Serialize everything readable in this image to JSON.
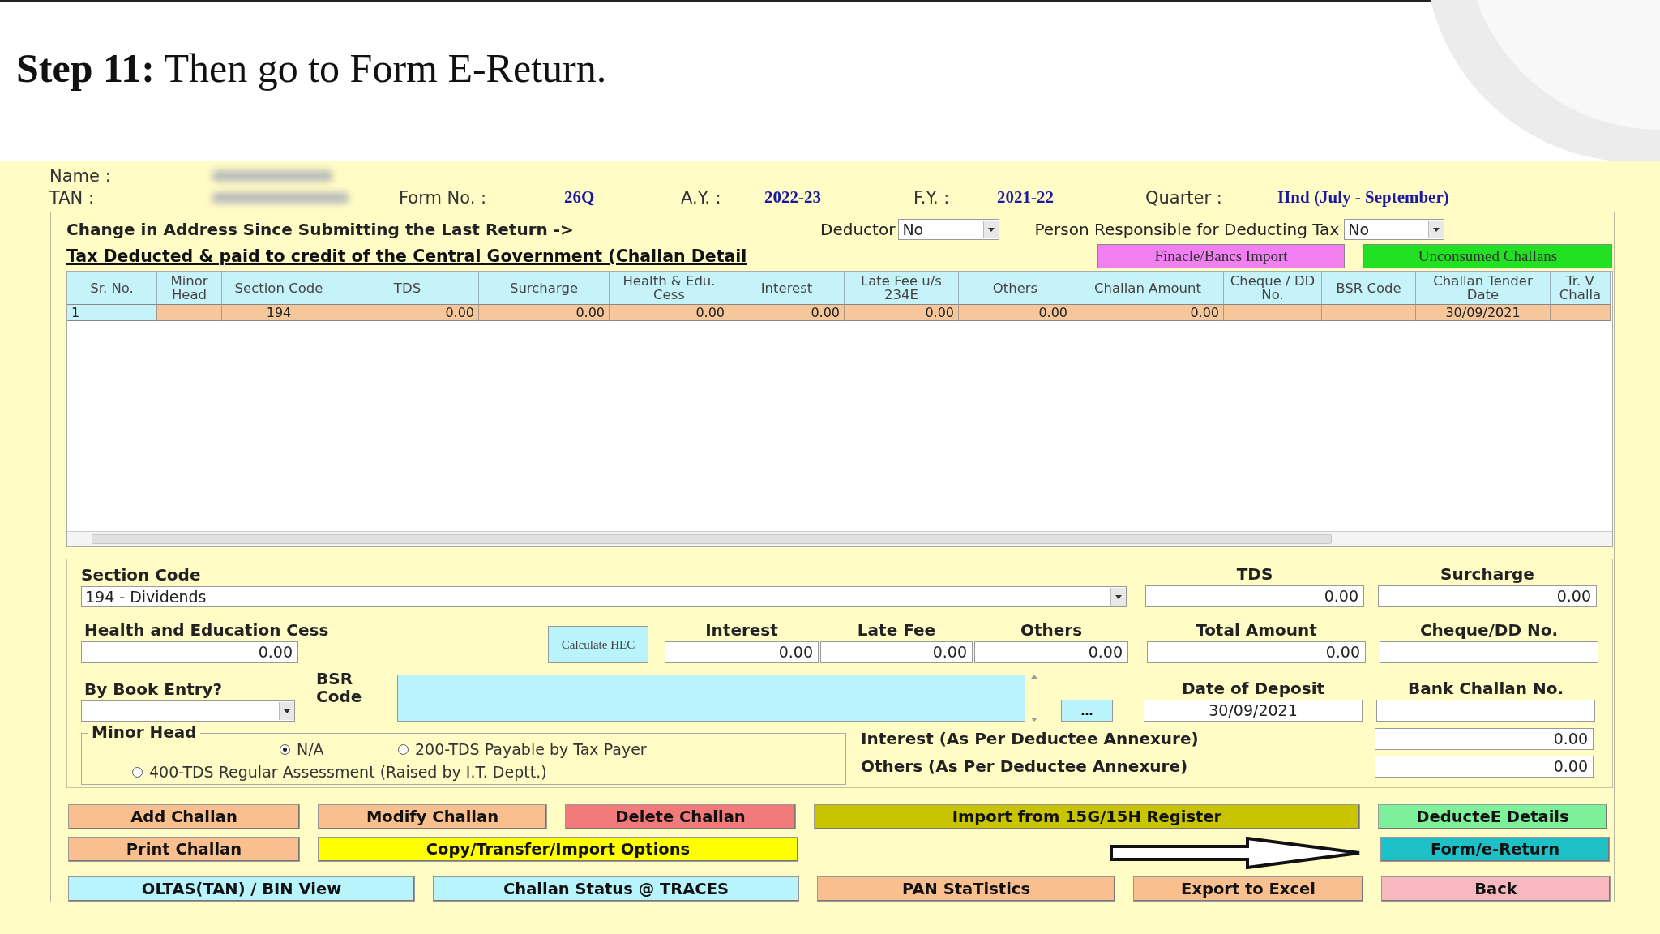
{
  "slide_heading": "**Step 11:** Then go to Form E-Return.",
  "header": {
    "name_label": "Name :",
    "tan_label": "TAN :",
    "form_label": "Form No. :",
    "form_value": "26Q",
    "ay_label": "A.Y. :",
    "ay_value": "2022-23",
    "fy_label": "F.Y. :",
    "fy_value": "2021-22",
    "quarter_label": "Quarter :",
    "quarter_value": "IInd (July - September)"
  },
  "address_change": {
    "label": "Change in Address Since Submitting the Last Return ->",
    "deductor_label": "Deductor",
    "deductor_value": "No",
    "person_label": "Person Responsible for Deducting Tax",
    "person_value": "No"
  },
  "challan_title": "Tax Deducted & paid to credit of the Central Government (Challan Detail",
  "top_buttons": [
    {
      "label": "Finacle/Bancs Import",
      "color": "#f27ff2"
    },
    {
      "label": "Unconsumed Challans",
      "color": "#22e022"
    }
  ],
  "table": {
    "columns": [
      "Sr. No.",
      "Minor Head",
      "Section Code",
      "TDS",
      "Surcharge",
      "Health & Edu. Cess",
      "Interest",
      "Late Fee u/s 234E",
      "Others",
      "Challan Amount",
      "Cheque / DD No.",
      "BSR Code",
      "Challan Tender Date",
      "Tr. V Challa"
    ],
    "rows": [
      {
        "cells": [
          {
            "text": "1"
          },
          {},
          {
            "text": "194"
          },
          {
            "text": "0.00"
          },
          {
            "text": "0.00"
          },
          {
            "text": "0.00"
          },
          {
            "text": "0.00"
          },
          {
            "text": "0.00"
          },
          {
            "text": "0.00"
          },
          {
            "text": "0.00"
          },
          {},
          {},
          {
            "text": "30/09/2021"
          },
          {}
        ]
      }
    ]
  },
  "form": {
    "section_code_label": "Section Code",
    "section_code_value": "194 - Dividends",
    "tds_label": "TDS",
    "tds_value": "0.00",
    "surcharge_label": "Surcharge",
    "surcharge_value": "0.00",
    "cess_label": "Health and Education Cess",
    "cess_value": "0.00",
    "calculate_button": "Calculate HEC",
    "interest_label": "Interest",
    "interest_value": "0.00",
    "late_fee_label": "Late Fee",
    "late_fee_value": "0.00",
    "others_label": "Others",
    "others_value": "0.00",
    "total_label": "Total Amount",
    "total_value": "0.00",
    "cheque_label": "Cheque/DD No.",
    "book_entry_label": "By Book Entry?",
    "bsr_label": "BSR Code",
    "browse_button": "...",
    "deposit_label": "Date of Deposit",
    "deposit_value": "30/09/2021",
    "bank_challan_label": "Bank Challan No.",
    "minor_head_label": "Minor Head",
    "minor_head_options": [
      {
        "label": "N/A",
        "selected": true
      },
      {
        "label": "200-TDS Payable by Tax Payer",
        "selected": false
      },
      {
        "label": "400-TDS Regular Assessment (Raised by I.T. Deptt.)",
        "selected": false
      }
    ],
    "interest_annexure_label": "Interest (As Per Deductee Annexure)",
    "interest_annexure_value": "0.00",
    "others_annexure_label": "Others (As Per Deductee Annexure)",
    "others_annexure_value": "0.00"
  },
  "buttons": [
    [
      {
        "label": "Add Challan",
        "color": "#f9bf8f"
      },
      {
        "label": "Modify Challan",
        "color": "#f9bf8f"
      },
      {
        "label": "Delete Challan",
        "color": "#f27a7a"
      },
      {
        "label": "Import from 15G/15H Register",
        "color": "#c8c400"
      },
      {
        "label": "DeducteE Details",
        "color": "#7ff09a"
      }
    ],
    [
      {
        "label": "Print Challan",
        "color": "#f9bf8f"
      },
      {
        "label": "Copy/Transfer/Import Options",
        "color": "#ffff00"
      },
      {
        "label": "Form/e-Return",
        "color": "#1ec0c8"
      }
    ],
    [
      {
        "label": "OLTAS(TAN) / BIN View",
        "color": "#b8f4fc"
      },
      {
        "label": "Challan Status @ TRACES",
        "color": "#b8f4fc"
      },
      {
        "label": "PAN StaTistics",
        "color": "#f9bf8f"
      },
      {
        "label": "Export to Excel",
        "color": "#f9bf8f"
      },
      {
        "label": "Back",
        "color": "#f7b8c0"
      }
    ]
  ]
}
